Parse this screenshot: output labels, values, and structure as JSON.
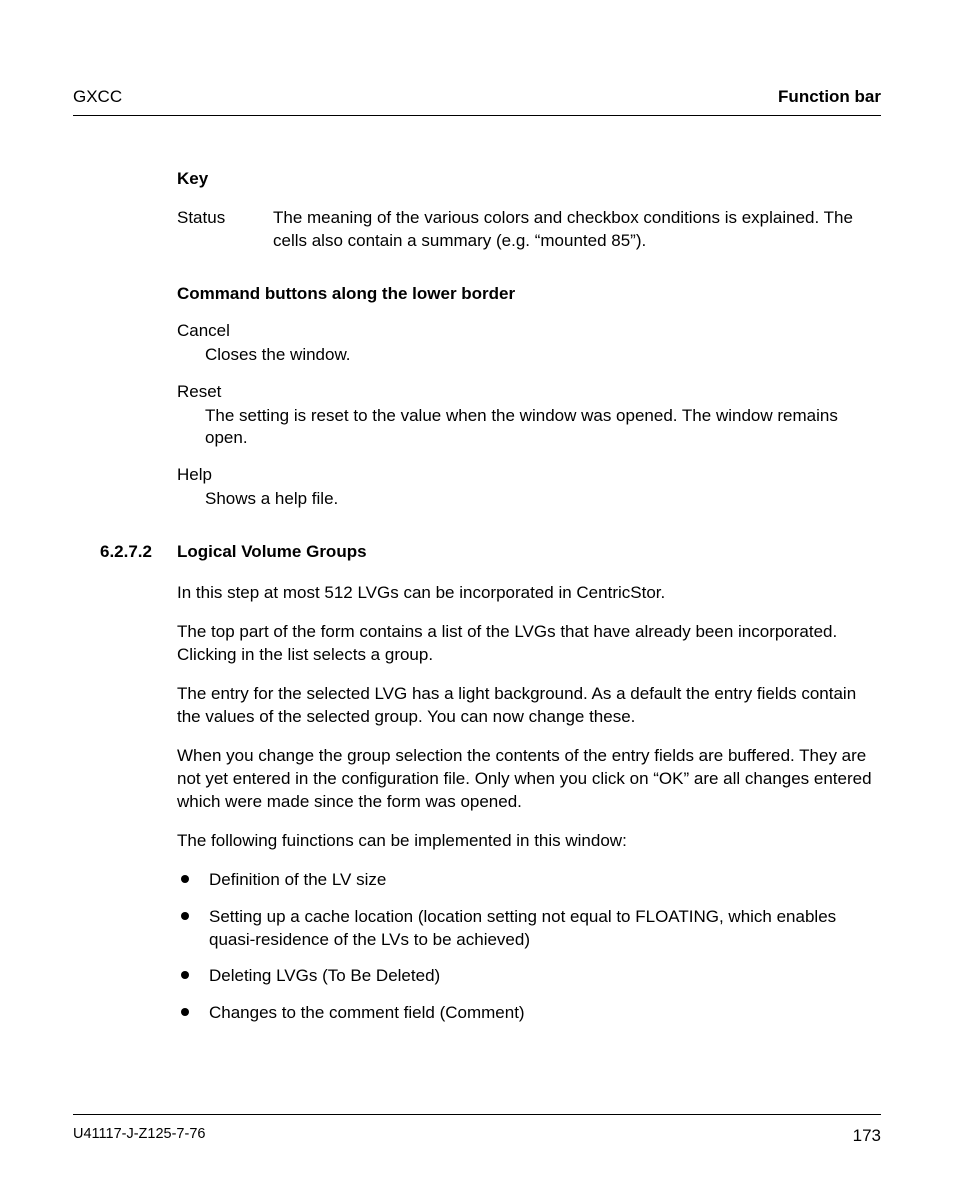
{
  "header": {
    "left": "GXCC",
    "right": "Function bar"
  },
  "key": {
    "heading": "Key",
    "rows": [
      {
        "term": "Status",
        "def": "The meaning of the various colors and checkbox conditions is explained. The cells also contain a summary (e.g. “mounted 85”)."
      }
    ]
  },
  "cmd": {
    "heading": "Command buttons along the lower border",
    "items": [
      {
        "term": "Cancel",
        "def": "Closes the window."
      },
      {
        "term": "Reset",
        "def": "The setting is reset to the value when the window was opened. The window remains open."
      },
      {
        "term": "Help",
        "def": "Shows a help file."
      }
    ]
  },
  "section": {
    "num": "6.2.7.2",
    "title": "Logical Volume Groups",
    "paras": [
      "In this step at most 512 LVGs can be incorporated in CentricStor.",
      "The top part of the form contains a list of the LVGs that have already been incorporated. Clicking in the list selects a group.",
      "The entry for the selected LVG has a light background. As a default the entry fields contain the values of the selected group. You can now change these.",
      "When you change the group selection the contents of the entry fields are buffered. They are not yet entered in the configuration file. Only when you click on “OK” are all changes entered which were made since the form was opened.",
      "The following fuinctions can be implemented in this window:"
    ],
    "bullets": [
      "Definition of the LV size",
      "Setting up a cache location (location setting not equal to FLOATING, which enables quasi-residence of the LVs to be achieved)",
      "Deleting LVGs (To Be Deleted)",
      "Changes to the comment field (Comment)"
    ]
  },
  "footer": {
    "left": "U41117-J-Z125-7-76",
    "right": "173"
  }
}
